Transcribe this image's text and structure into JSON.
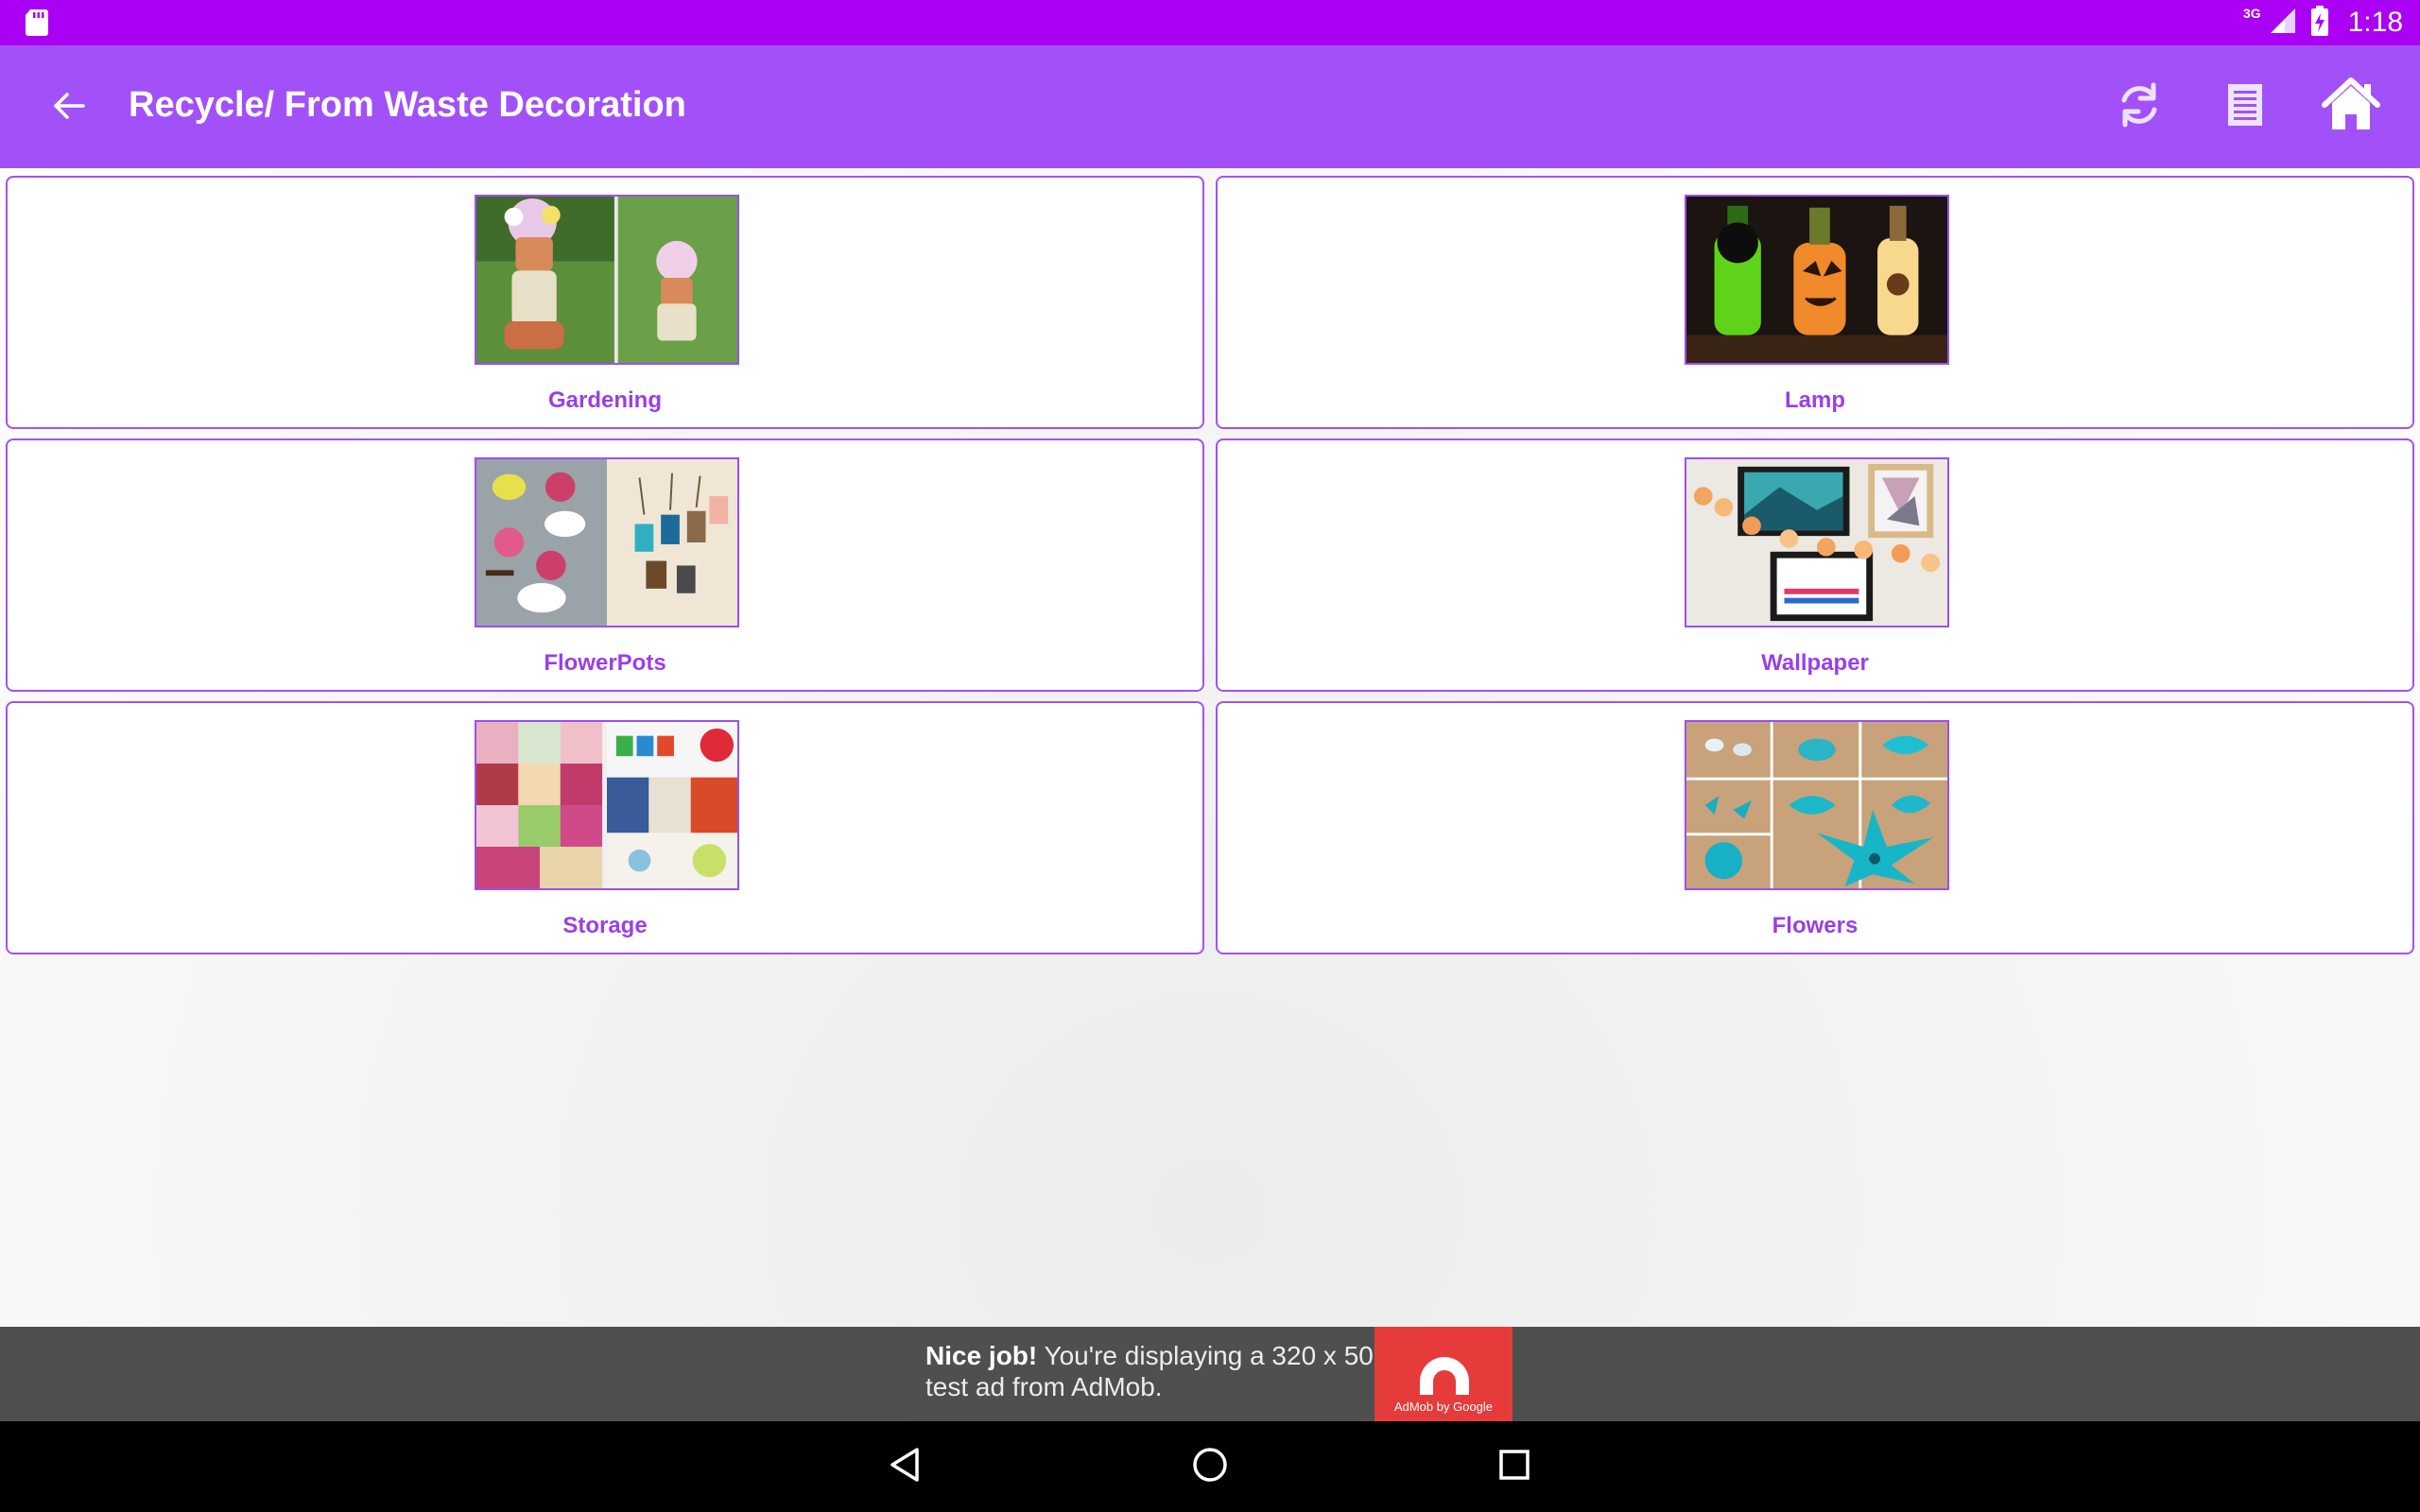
{
  "status_bar": {
    "network": "3G",
    "time": "1:18",
    "sd_icon": "sd-card-icon",
    "signal_icon": "signal-icon",
    "battery_icon": "battery-charging-icon"
  },
  "app_bar": {
    "title": "Recycle/ From Waste Decoration",
    "back_icon": "arrow-back-icon",
    "actions": [
      "refresh-icon",
      "list-icon",
      "home-icon"
    ],
    "color": "#a251f8"
  },
  "categories": [
    {
      "label": "Gardening"
    },
    {
      "label": "Lamp"
    },
    {
      "label": "FlowerPots"
    },
    {
      "label": "Wallpaper"
    },
    {
      "label": "Storage"
    },
    {
      "label": "Flowers"
    }
  ],
  "ad": {
    "bold": "Nice job!",
    "text": " You're displaying a 320 x 50 test ad from AdMob.",
    "logo_caption": "AdMob by Google"
  },
  "nav_bar": {
    "buttons": [
      "back-triangle-icon",
      "home-circle-icon",
      "recents-square-icon"
    ]
  },
  "colors": {
    "status_bar": "#aa00f4",
    "accent": "#a251f8",
    "label": "#9a3fe8"
  }
}
